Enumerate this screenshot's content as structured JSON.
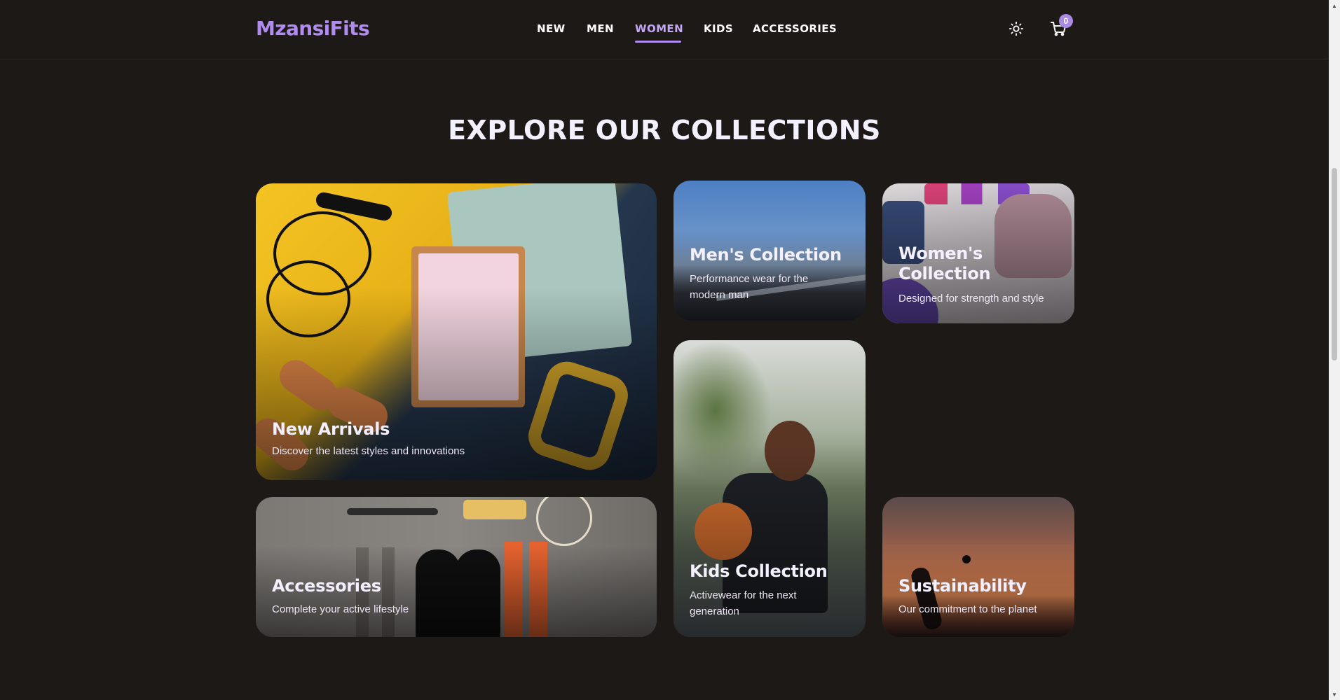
{
  "brand": {
    "name": "MzansiFits",
    "accent": "#b18cf0"
  },
  "nav": {
    "items": [
      {
        "label": "NEW",
        "active": false
      },
      {
        "label": "MEN",
        "active": false
      },
      {
        "label": "WOMEN",
        "active": true
      },
      {
        "label": "KIDS",
        "active": false
      },
      {
        "label": "ACCESSORIES",
        "active": false
      }
    ]
  },
  "header": {
    "theme_icon": "sun-icon",
    "cart_icon": "cart-icon",
    "cart_count": "0"
  },
  "section": {
    "title": "EXPLORE OUR COLLECTIONS"
  },
  "collections": [
    {
      "title": "New Arrivals",
      "description": "Discover the latest styles and innovations"
    },
    {
      "title": "Men's Collection",
      "description": "Performance wear for the modern man"
    },
    {
      "title": "Women's Collection",
      "description": "Designed for strength and style"
    },
    {
      "title": "Kids Collection",
      "description": "Activewear for the next generation"
    },
    {
      "title": "Accessories",
      "description": "Complete your active lifestyle"
    },
    {
      "title": "Sustainability",
      "description": "Our commitment to the planet"
    }
  ],
  "colors": {
    "background": "#1d1917",
    "nav_active": "#c3a6f7",
    "badge": "#a98be4"
  }
}
